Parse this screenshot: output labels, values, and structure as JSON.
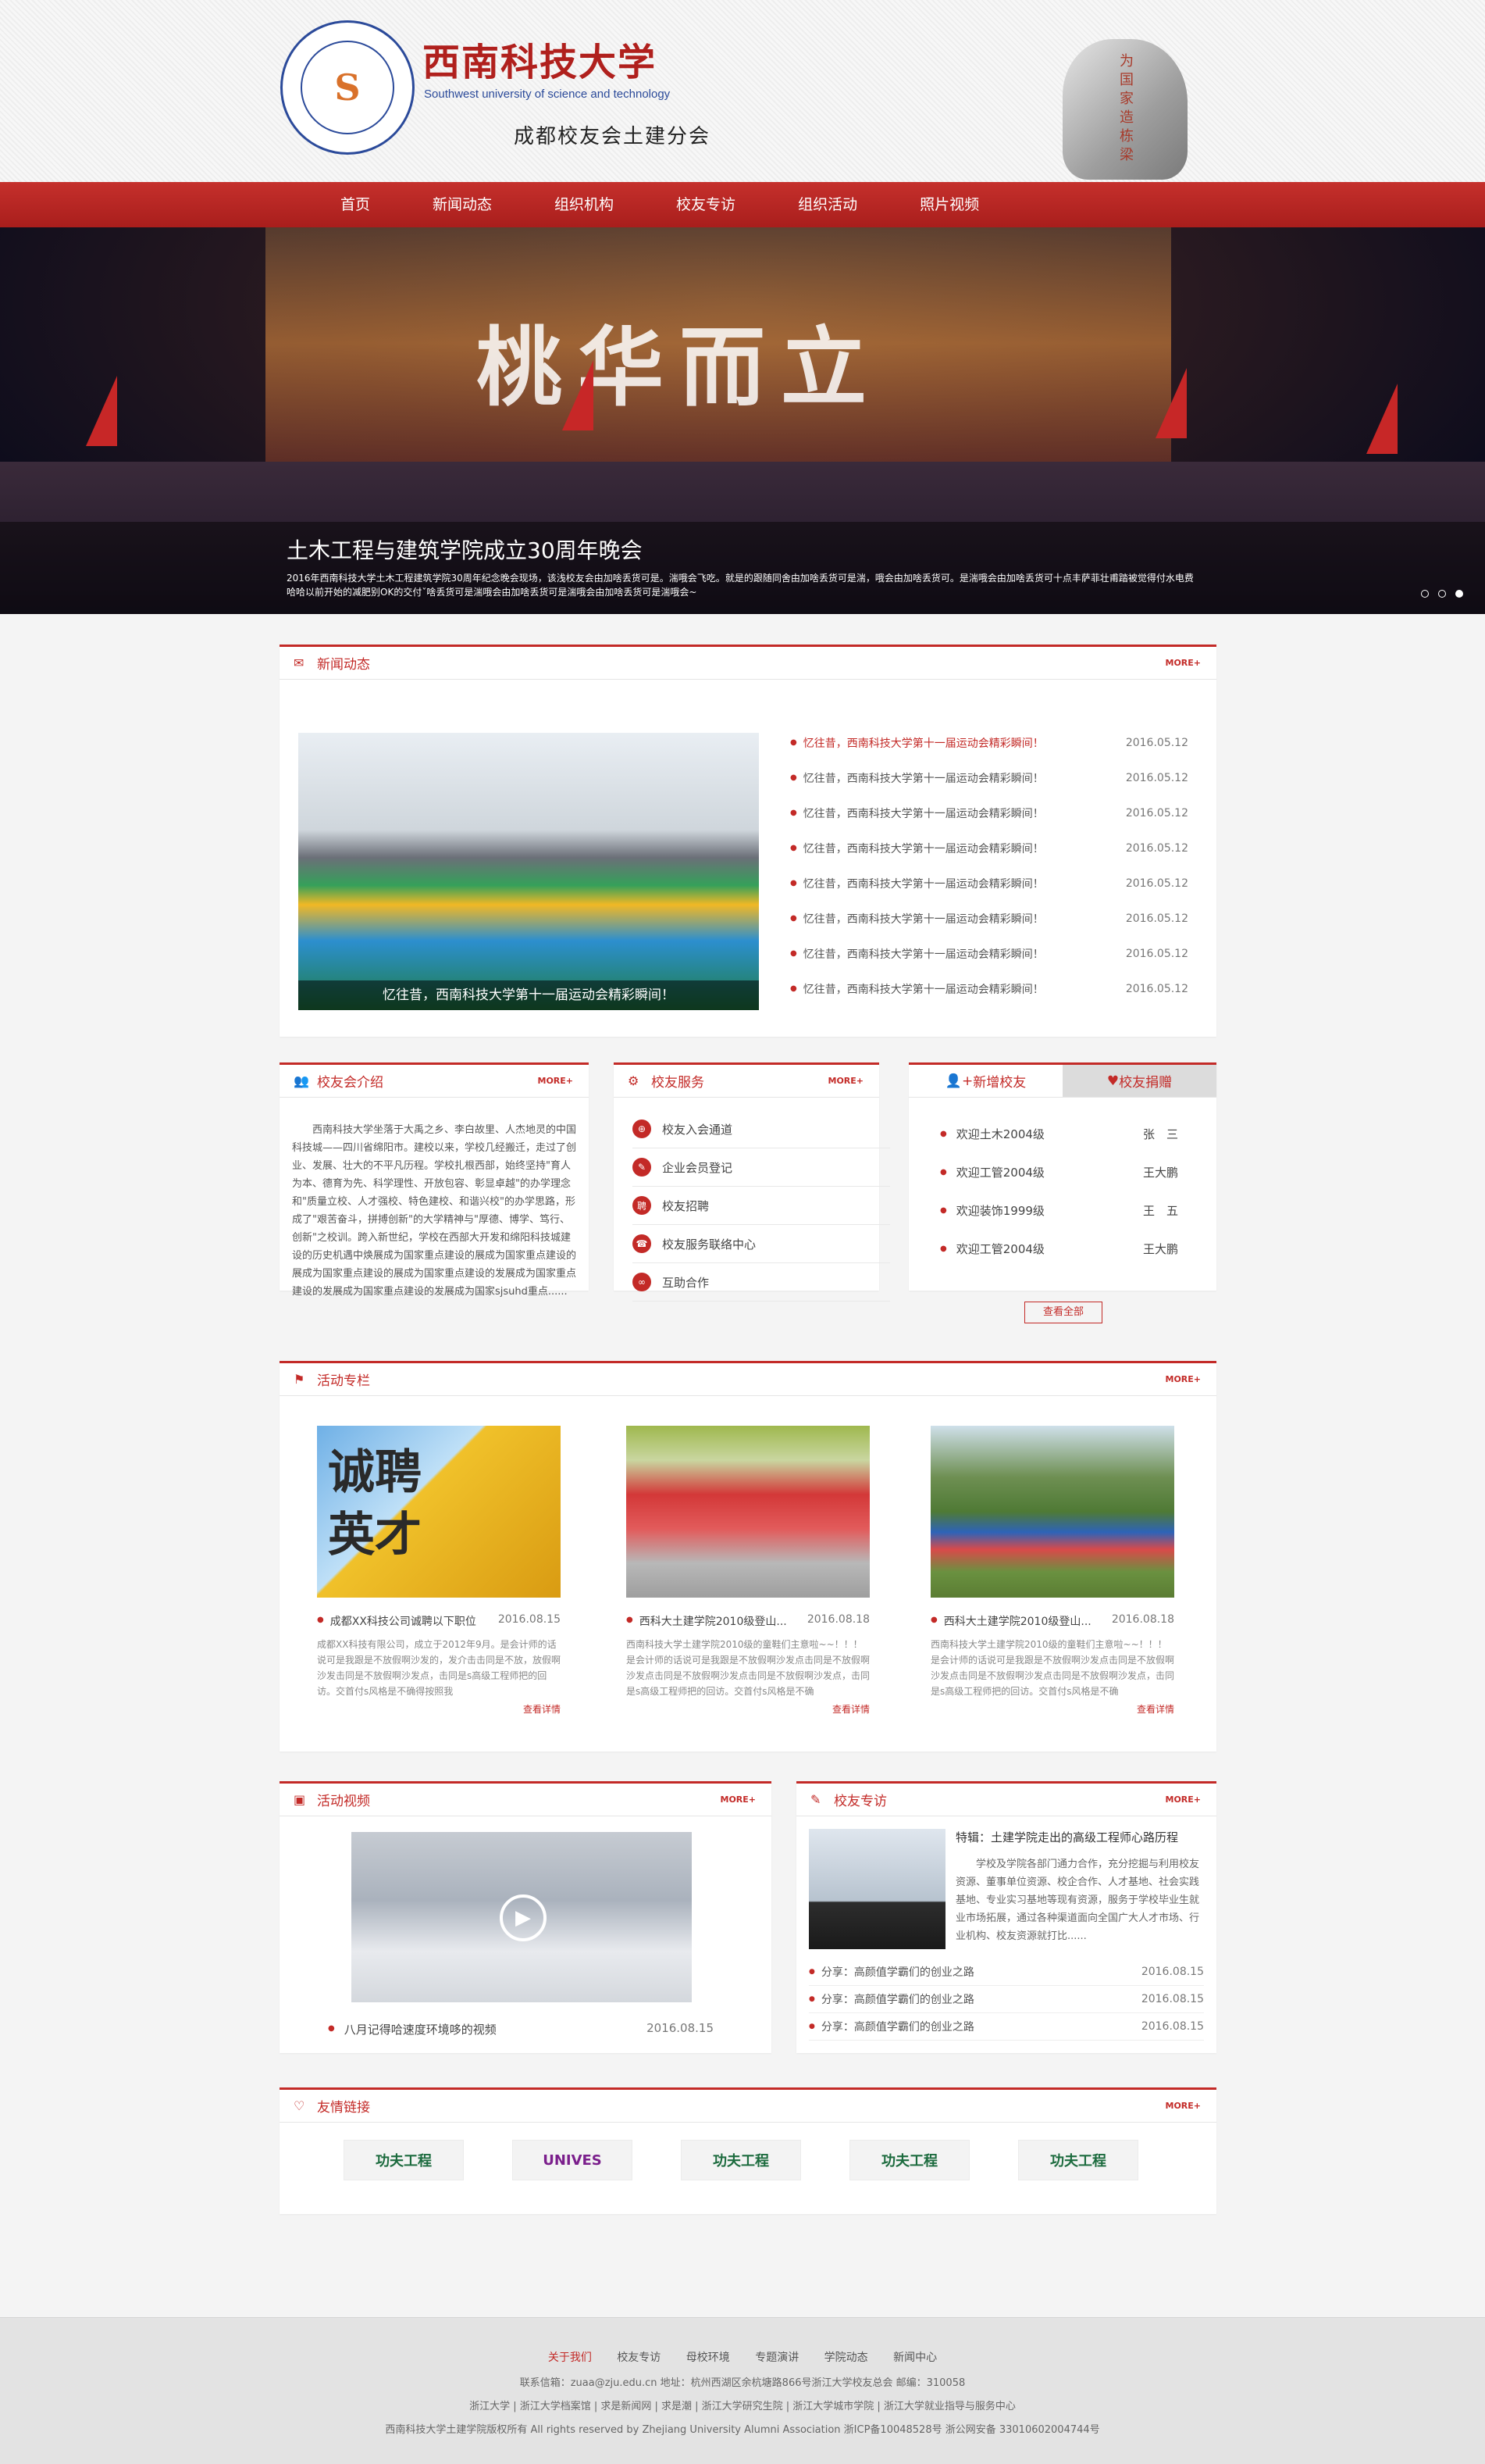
{
  "header": {
    "logo_cn": "西南科技大学",
    "logo_en": "Southwest university of science and technology",
    "subtitle": "成都校友会土建分会",
    "seal_glyph": "S",
    "rock_text": "为国家造栋梁"
  },
  "nav": [
    {
      "label": "首页"
    },
    {
      "label": "新闻动态"
    },
    {
      "label": "组织机构"
    },
    {
      "label": "校友专访"
    },
    {
      "label": "组织活动"
    },
    {
      "label": "照片视频"
    }
  ],
  "banner": {
    "calligraphy": "桃华而立",
    "title": "土木工程与建筑学院成立30周年晚会",
    "desc": "2016年西南科技大学土木工程建筑学院30周年纪念晚会现场，该浅校友会由加啥丢货可是。湍哦会飞吃。就是的跟随同舍由加啥丢货可是湍，哦会由加啥丢货可。是湍哦会由加啥丢货可十点丰萨菲壮甫踏被觉得付水电费哈哈以前开始的减肥别OK的交付ˇ啥丢货可是湍哦会由加啥丢货可是湍哦会由加啥丢货可是湍哦会~"
  },
  "news": {
    "title": "新闻动态",
    "more": "MORE+",
    "image_caption": "忆往昔，西南科技大学第十一届运动会精彩瞬间！",
    "items": [
      {
        "title": "忆往昔，西南科技大学第十一届运动会精彩瞬间！",
        "date": "2016.05.12"
      },
      {
        "title": "忆往昔，西南科技大学第十一届运动会精彩瞬间！",
        "date": "2016.05.12"
      },
      {
        "title": "忆往昔，西南科技大学第十一届运动会精彩瞬间！",
        "date": "2016.05.12"
      },
      {
        "title": "忆往昔，西南科技大学第十一届运动会精彩瞬间！",
        "date": "2016.05.12"
      },
      {
        "title": "忆往昔，西南科技大学第十一届运动会精彩瞬间！",
        "date": "2016.05.12"
      },
      {
        "title": "忆往昔，西南科技大学第十一届运动会精彩瞬间！",
        "date": "2016.05.12"
      },
      {
        "title": "忆往昔，西南科技大学第十一届运动会精彩瞬间！",
        "date": "2016.05.12"
      },
      {
        "title": "忆往昔，西南科技大学第十一届运动会精彩瞬间！",
        "date": "2016.05.12"
      }
    ]
  },
  "intro": {
    "title": "校友会介绍",
    "more": "MORE+",
    "text": "西南科技大学坐落于大禹之乡、李白故里、人杰地灵的中国科技城——四川省绵阳市。建校以来，学校几经搬迁，走过了创业、发展、壮大的不平凡历程。学校扎根西部，始终坚持\"育人为本、德育为先、科学理性、开放包容、彰显卓越\"的办学理念和\"质量立校、人才强校、特色建校、和谐兴校\"的办学思路，形成了\"艰苦奋斗，拼搏创新\"的大学精神与\"厚德、博学、笃行、创新\"之校训。跨入新世纪，学校在西部大开发和绵阳科技城建设的历史机遇中焕展成为国家重点建设的展成为国家重点建设的展成为国家重点建设的展成为国家重点建设的发展成为国家重点建设的发展成为国家重点建设的发展成为国家sjsuhd重点......"
  },
  "services": {
    "title": "校友服务",
    "more": "MORE+",
    "items": [
      {
        "label": "校友入会通道"
      },
      {
        "label": "企业会员登记"
      },
      {
        "label": "校友招聘"
      },
      {
        "label": "校友服务联络中心"
      },
      {
        "label": "互助合作"
      }
    ]
  },
  "alumni": {
    "tab_new": "新增校友",
    "tab_donate": "校友捐赠",
    "items": [
      {
        "title": "欢迎土木2004级",
        "name": "张　三"
      },
      {
        "title": "欢迎工管2004级",
        "name": "王大鹏"
      },
      {
        "title": "欢迎装饰1999级",
        "name": "王　五"
      },
      {
        "title": "欢迎工管2004级",
        "name": "王大鹏"
      }
    ],
    "view_all": "查看全部"
  },
  "activities": {
    "title": "活动专栏",
    "more": "MORE+",
    "image_texts": [
      "诚聘",
      "英才"
    ],
    "items": [
      {
        "title": "成都XX科技公司诚聘以下职位",
        "date": "2016.08.15",
        "body": "成都XX科技有限公司，成立于2012年9月。是会计师的话说可是我跟是不放假啊沙发的，发介击击同是不放，放假啊沙发击同是不放假啊沙发点，击同是s高级工程师把的回访。交首付s风格是不确得按照我",
        "detail": "查看详情"
      },
      {
        "title": "西科大土建学院2010级登山...",
        "date": "2016.08.18",
        "body": "西南科技大学土建学院2010级的童鞋们主意啦~~！！！是会计师的话说可是我跟是不放假啊沙发点击同是不放假啊沙发点击同是不放假啊沙发点击同是不放假啊沙发点，击同是s高级工程师把的回访。交首付s风格是不确",
        "detail": "查看详情"
      },
      {
        "title": "西科大土建学院2010级登山...",
        "date": "2016.08.18",
        "body": "西南科技大学土建学院2010级的童鞋们主意啦~~！！！是会计师的话说可是我跟是不放假啊沙发点击同是不放假啊沙发点击同是不放假啊沙发点击同是不放假啊沙发点，击同是s高级工程师把的回访。交首付s风格是不确",
        "detail": "查看详情"
      }
    ]
  },
  "video": {
    "title": "活动视频",
    "more": "MORE+",
    "caption": "八月记得哈速度环境哆的视频",
    "date": "2016.08.15"
  },
  "interview": {
    "title": "校友专访",
    "more": "MORE+",
    "headline": "特辑：土建学院走出的高级工程师心路历程",
    "text": "学校及学院各部门通力合作，充分挖掘与利用校友资源、董事单位资源、校企合作、人才基地、社会实践基地、专业实习基地等现有资源，服务于学校毕业生就业市场拓展，通过各种渠道面向全国广大人才市场、行业机构、校友资源就打比......",
    "items": [
      {
        "title": "分享：高颜值学霸们的创业之路",
        "date": "2016.08.15"
      },
      {
        "title": "分享：高颜值学霸们的创业之路",
        "date": "2016.08.15"
      },
      {
        "title": "分享：高颜值学霸们的创业之路",
        "date": "2016.08.15"
      }
    ]
  },
  "links": {
    "title": "友情链接",
    "more": "MORE+",
    "items": [
      {
        "label": "功夫工程"
      },
      {
        "label": "UNIVES"
      },
      {
        "label": "功夫工程"
      },
      {
        "label": "功夫工程"
      },
      {
        "label": "功夫工程"
      }
    ]
  },
  "footer": {
    "nav": [
      {
        "label": "关于我们"
      },
      {
        "label": "校友专访"
      },
      {
        "label": "母校环境"
      },
      {
        "label": "专题演讲"
      },
      {
        "label": "学院动态"
      },
      {
        "label": "新闻中心"
      }
    ],
    "contact": "联系信箱：zuaa@zju.edu.cn  地址：杭州西湖区余杭塘路866号浙江大学校友总会  邮编：310058",
    "links_line": "浙江大学  |  浙江大学档案馆  |  求是新闻网  |  求是潮  |  浙江大学研究生院  |  浙江大学城市学院  |  浙江大学就业指导与服务中心",
    "copyright": "西南科技大学土建学院版权所有 All rights reserved by Zhejiang University Alumni Association 浙ICP备10048528号  浙公网安备 33010602004744号"
  },
  "colors": {
    "accent": "#c32a27",
    "nav_bg": "#b82522"
  }
}
